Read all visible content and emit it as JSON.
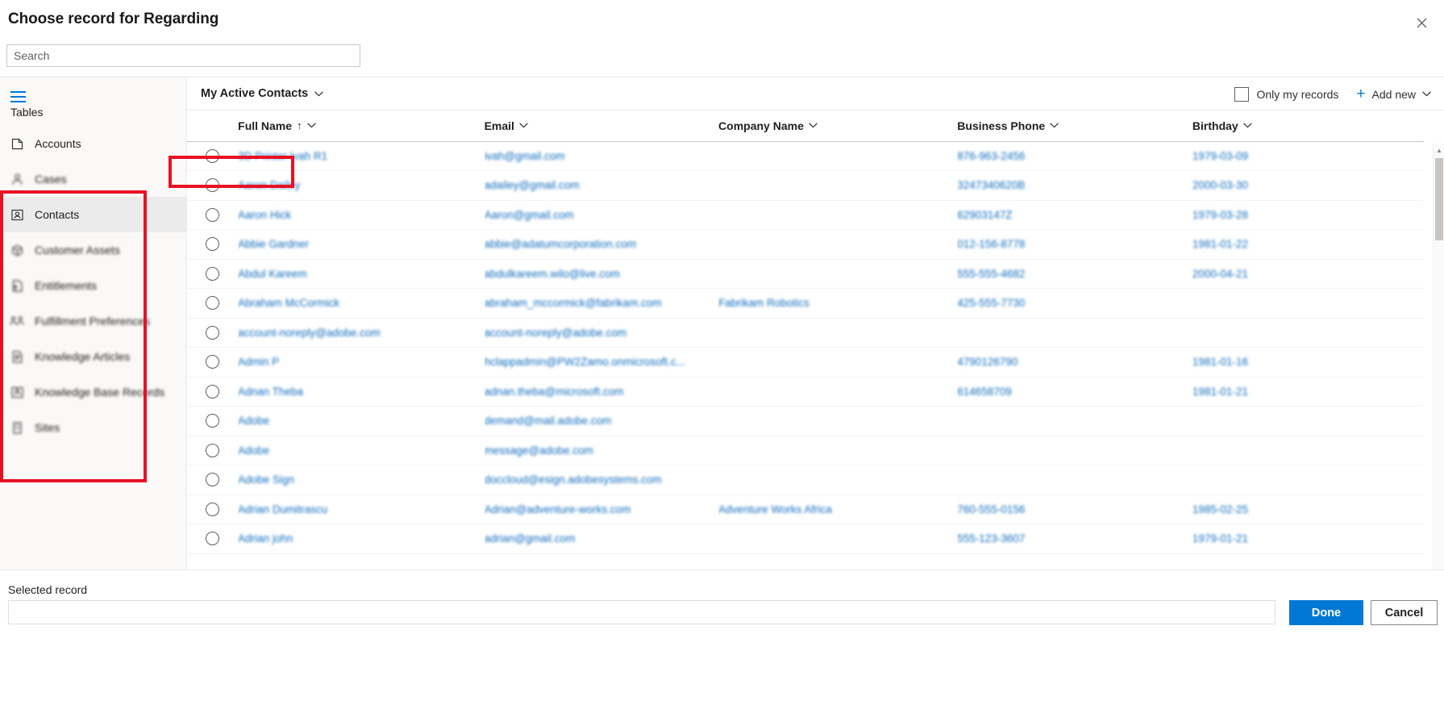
{
  "dialog": {
    "title": "Choose record for Regarding",
    "close_icon": "close-icon"
  },
  "search": {
    "placeholder": "Search",
    "value": ""
  },
  "sidebar": {
    "menu_icon": "hamburger-menu-icon",
    "heading": "Tables",
    "items": [
      {
        "label": "Accounts",
        "icon": "account-icon",
        "selected": false,
        "blurred": false
      },
      {
        "label": "Cases",
        "icon": "case-person-icon",
        "selected": false,
        "blurred": true
      },
      {
        "label": "Contacts",
        "icon": "contact-icon",
        "selected": true,
        "blurred": false
      },
      {
        "label": "Customer Assets",
        "icon": "box-asset-icon",
        "selected": false,
        "blurred": true
      },
      {
        "label": "Entitlements",
        "icon": "entitlement-document-icon",
        "selected": false,
        "blurred": true
      },
      {
        "label": "Fulfillment Preferences",
        "icon": "people-group-icon",
        "selected": false,
        "blurred": true
      },
      {
        "label": "Knowledge Articles",
        "icon": "article-document-icon",
        "selected": false,
        "blurred": true
      },
      {
        "label": "Knowledge Base Records",
        "icon": "knowledge-base-icon",
        "selected": false,
        "blurred": true
      },
      {
        "label": "Sites",
        "icon": "site-building-icon",
        "selected": false,
        "blurred": true
      }
    ]
  },
  "toolbar": {
    "view_name": "My Active Contacts",
    "view_caret_icon": "chevron-down-icon",
    "only_my_records_label": "Only my records",
    "only_my_records_checked": false,
    "add_new_label": "Add new",
    "add_new_plus_icon": "plus-icon",
    "add_new_caret_icon": "chevron-down-icon"
  },
  "grid": {
    "columns": [
      {
        "key": "select",
        "label": "",
        "sorted": false
      },
      {
        "key": "fullname",
        "label": "Full Name",
        "sorted": true,
        "sort_dir": "asc"
      },
      {
        "key": "email",
        "label": "Email",
        "sorted": false
      },
      {
        "key": "company",
        "label": "Company Name",
        "sorted": false
      },
      {
        "key": "phone",
        "label": "Business Phone",
        "sorted": false
      },
      {
        "key": "birthday",
        "label": "Birthday",
        "sorted": false
      }
    ],
    "rows": [
      {
        "fullname": "3D Printer Ivah R1",
        "email": "ivah@gmail.com",
        "company": "",
        "phone": "876-963-2456",
        "birthday": "1979-03-09"
      },
      {
        "fullname": "Aaron Dailey",
        "email": "adailey@gmail.com",
        "company": "",
        "phone": "3247340620B",
        "birthday": "2000-03-30"
      },
      {
        "fullname": "Aaron Hick",
        "email": "Aaron@gmail.com",
        "company": "",
        "phone": "62903147Z",
        "birthday": "1979-03-28"
      },
      {
        "fullname": "Abbie Gardner",
        "email": "abbie@adatumcorporation.com",
        "company": "",
        "phone": "012-156-8778",
        "birthday": "1981-01-22"
      },
      {
        "fullname": "Abdul Kareem",
        "email": "abdulkareem.wilo@live.com",
        "company": "",
        "phone": "555-555-4682",
        "birthday": "2000-04-21"
      },
      {
        "fullname": "Abraham McCormick",
        "email": "abraham_mccormick@fabrikam.com",
        "company": "Fabrikam Robotics",
        "phone": "425-555-7730",
        "birthday": ""
      },
      {
        "fullname": "account-noreply@adobe.com",
        "email": "account-noreply@adobe.com",
        "company": "",
        "phone": "",
        "birthday": ""
      },
      {
        "fullname": "Admin P",
        "email": "hclappadmin@PW2Zamo.onmicrosoft.c...",
        "company": "",
        "phone": "4790126790",
        "birthday": "1981-01-16"
      },
      {
        "fullname": "Adnan Theba",
        "email": "adnan.theba@microsoft.com",
        "company": "",
        "phone": "614658709",
        "birthday": "1981-01-21"
      },
      {
        "fullname": "Adobe",
        "email": "demand@mail.adobe.com",
        "company": "",
        "phone": "",
        "birthday": ""
      },
      {
        "fullname": "Adobe",
        "email": "message@adobe.com",
        "company": "",
        "phone": "",
        "birthday": ""
      },
      {
        "fullname": "Adobe Sign",
        "email": "doccloud@esign.adobesystems.com",
        "company": "",
        "phone": "",
        "birthday": ""
      },
      {
        "fullname": "Adrian Dumitrascu",
        "email": "Adrian@adventure-works.com",
        "company": "Adventure Works Africa",
        "phone": "760-555-0156",
        "birthday": "1985-02-25"
      },
      {
        "fullname": "Adrian john",
        "email": "adrian@gmail.com",
        "company": "",
        "phone": "555-123-3607",
        "birthday": "1979-01-21"
      }
    ]
  },
  "footer": {
    "selected_record_label": "Selected record",
    "selected_record_value": "",
    "done_label": "Done",
    "cancel_label": "Cancel"
  },
  "annotations": {
    "highlight_color": "#e81123",
    "boxes": [
      "sidebar-tables-list",
      "view-selector"
    ]
  }
}
